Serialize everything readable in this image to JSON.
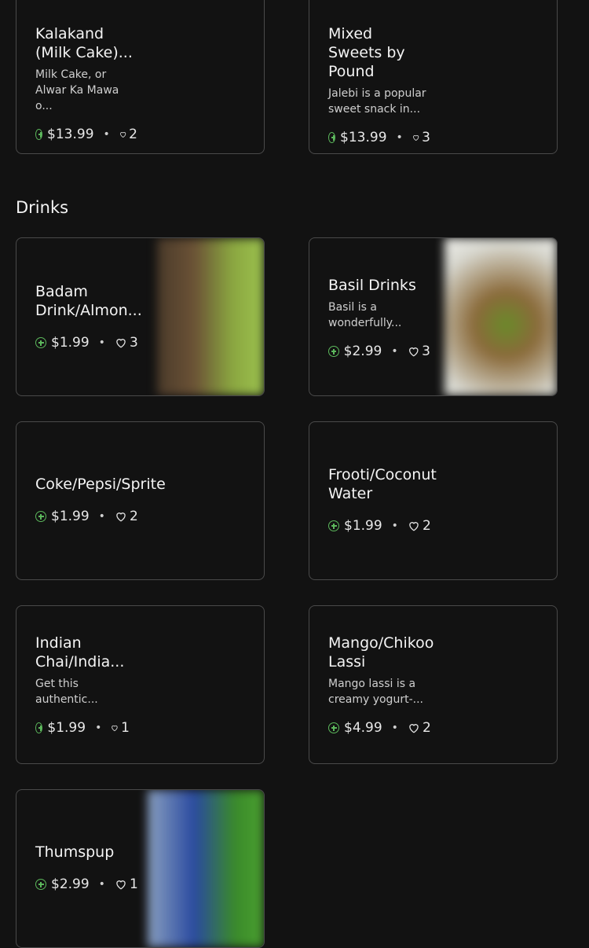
{
  "section_heading": "Drinks",
  "items": [
    {
      "title": "Kalakand (Milk Cake)...",
      "desc": "Milk Cake, or Alwar Ka Mawa o...",
      "price": "$13.99",
      "likes": "2"
    },
    {
      "title": "Mixed Sweets by Pound",
      "desc": "Jalebi is a popular sweet snack in...",
      "price": "$13.99",
      "likes": "3"
    },
    {
      "title": "Badam Drink/Almon...",
      "desc": "",
      "price": "$1.99",
      "likes": "3"
    },
    {
      "title": "Basil Drinks",
      "desc": "Basil is a wonderfully...",
      "price": "$2.99",
      "likes": "3"
    },
    {
      "title": "Coke/Pepsi/Sprite",
      "desc": "",
      "price": "$1.99",
      "likes": "2"
    },
    {
      "title": "Frooti/Coconut Water",
      "desc": "",
      "price": "$1.99",
      "likes": "2"
    },
    {
      "title": "Indian Chai/India...",
      "desc": "Get this authentic...",
      "price": "$1.99",
      "likes": "1"
    },
    {
      "title": "Mango/Chikoo Lassi",
      "desc": "Mango lassi is a creamy yogurt-...",
      "price": "$4.99",
      "likes": "2"
    },
    {
      "title": "Thumspup",
      "desc": "",
      "price": "$2.99",
      "likes": "1"
    }
  ],
  "colors": {
    "accent": "#5cb85c",
    "background": "#121212",
    "border": "#4a4a4a"
  }
}
